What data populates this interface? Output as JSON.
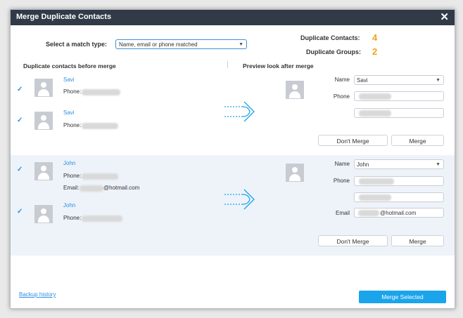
{
  "dialog": {
    "title": "Merge Duplicate Contacts"
  },
  "match": {
    "label": "Select a match type:",
    "selected": "Name, email or phone matched"
  },
  "stats": {
    "contacts_label": "Duplicate Contacts:",
    "contacts_value": "4",
    "groups_label": "Duplicate Groups:",
    "groups_value": "2"
  },
  "columns": {
    "before": "Duplicate contacts before merge",
    "after": "Preview look after merge"
  },
  "group1": {
    "contacts": [
      {
        "name": "Savi",
        "phone_label": "Phone:"
      },
      {
        "name": "Savi",
        "phone_label": "Phone:"
      }
    ],
    "preview": {
      "name_label": "Name",
      "name_value": "Savi",
      "phone_label": "Phone"
    },
    "dont_merge": "Don't Merge",
    "merge": "Merge"
  },
  "group2": {
    "contacts": [
      {
        "name": "John",
        "phone_label": "Phone:",
        "email_label": "Email:",
        "email_suffix": "@hotmail.com"
      },
      {
        "name": "John",
        "phone_label": "Phone:"
      }
    ],
    "preview": {
      "name_label": "Name",
      "name_value": "John",
      "phone_label": "Phone",
      "email_label": "Email",
      "email_suffix": "@hotmail.com"
    },
    "dont_merge": "Don't Merge",
    "merge": "Merge"
  },
  "footer": {
    "backup_link": "Backup history",
    "merge_selected": "Merge Selected"
  },
  "colors": {
    "titlebar": "#313a47",
    "accent": "#1aa4ec",
    "count": "#f0a21e",
    "alt_row": "#edf3f9"
  }
}
